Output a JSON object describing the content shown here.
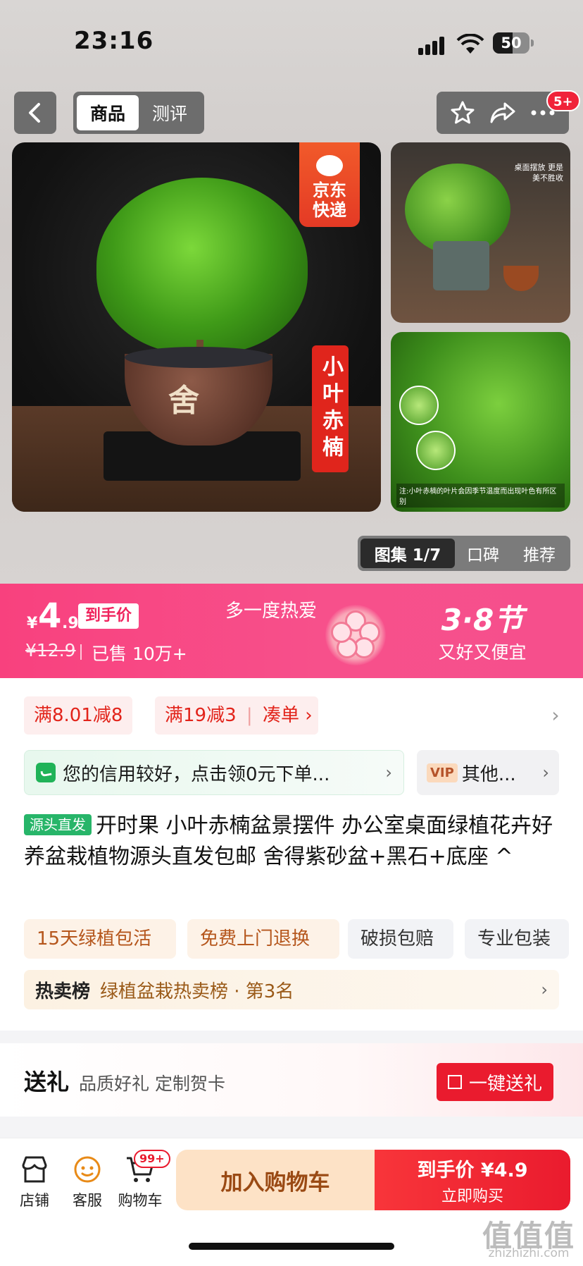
{
  "status": {
    "time": "23:16",
    "battery": "50"
  },
  "nav": {
    "tabs": [
      {
        "label": "商品",
        "active": true
      },
      {
        "label": "测评",
        "active": false
      }
    ],
    "badge": "5+"
  },
  "images": {
    "main_tag_express": "京东快递",
    "main_tag_name": "小叶赤楠",
    "pot_mark": "舍",
    "thumb1_caption": "桌面摆放 更是美不胜收",
    "thumb2_caption": "注:小叶赤楠的叶片会因季节温度而出现叶色有所区别"
  },
  "gallery": {
    "tabs": [
      "图集 1/7",
      "口碑",
      "推荐"
    ]
  },
  "promo": {
    "currency": "¥",
    "price_int": "4",
    "price_dec": ".9",
    "price_tag": "到手价",
    "original_price": "¥12.9",
    "sold": "已售 10万+",
    "slogan": "多一度热爱",
    "festival": "3·8节",
    "festival_sub": "又好又便宜"
  },
  "coupons": [
    "满8.01减8",
    "满19减3",
    "凑单 ›"
  ],
  "credit": {
    "text": "您的信用较好，点击领0元下单...",
    "vip_tag": "VIP",
    "vip_text": "其他..."
  },
  "product": {
    "source_tag": "源头直发",
    "title": "开时果 小叶赤楠盆景摆件 办公室桌面绿植花卉好养盆栽植物源头直发包邮 舍得紫砂盆+黑石+底座 ^"
  },
  "services": [
    "15天绿植包活",
    "免费上门退换",
    "破损包赔",
    "专业包装"
  ],
  "rank": {
    "label": "热卖榜",
    "text": "绿植盆栽热卖榜 · 第3名"
  },
  "gift": {
    "label": "送礼",
    "sub": "品质好礼 定制贺卡",
    "button": "一键送礼"
  },
  "bottom": {
    "tabs": [
      "店铺",
      "客服",
      "购物车"
    ],
    "cart_badge": "99+",
    "add_cart": "加入购物车",
    "buy_price_label": "到手价 ¥4.9",
    "buy_now": "立即购买"
  },
  "watermark": {
    "main": "值值值",
    "sub": "zhizhizhi.com"
  }
}
